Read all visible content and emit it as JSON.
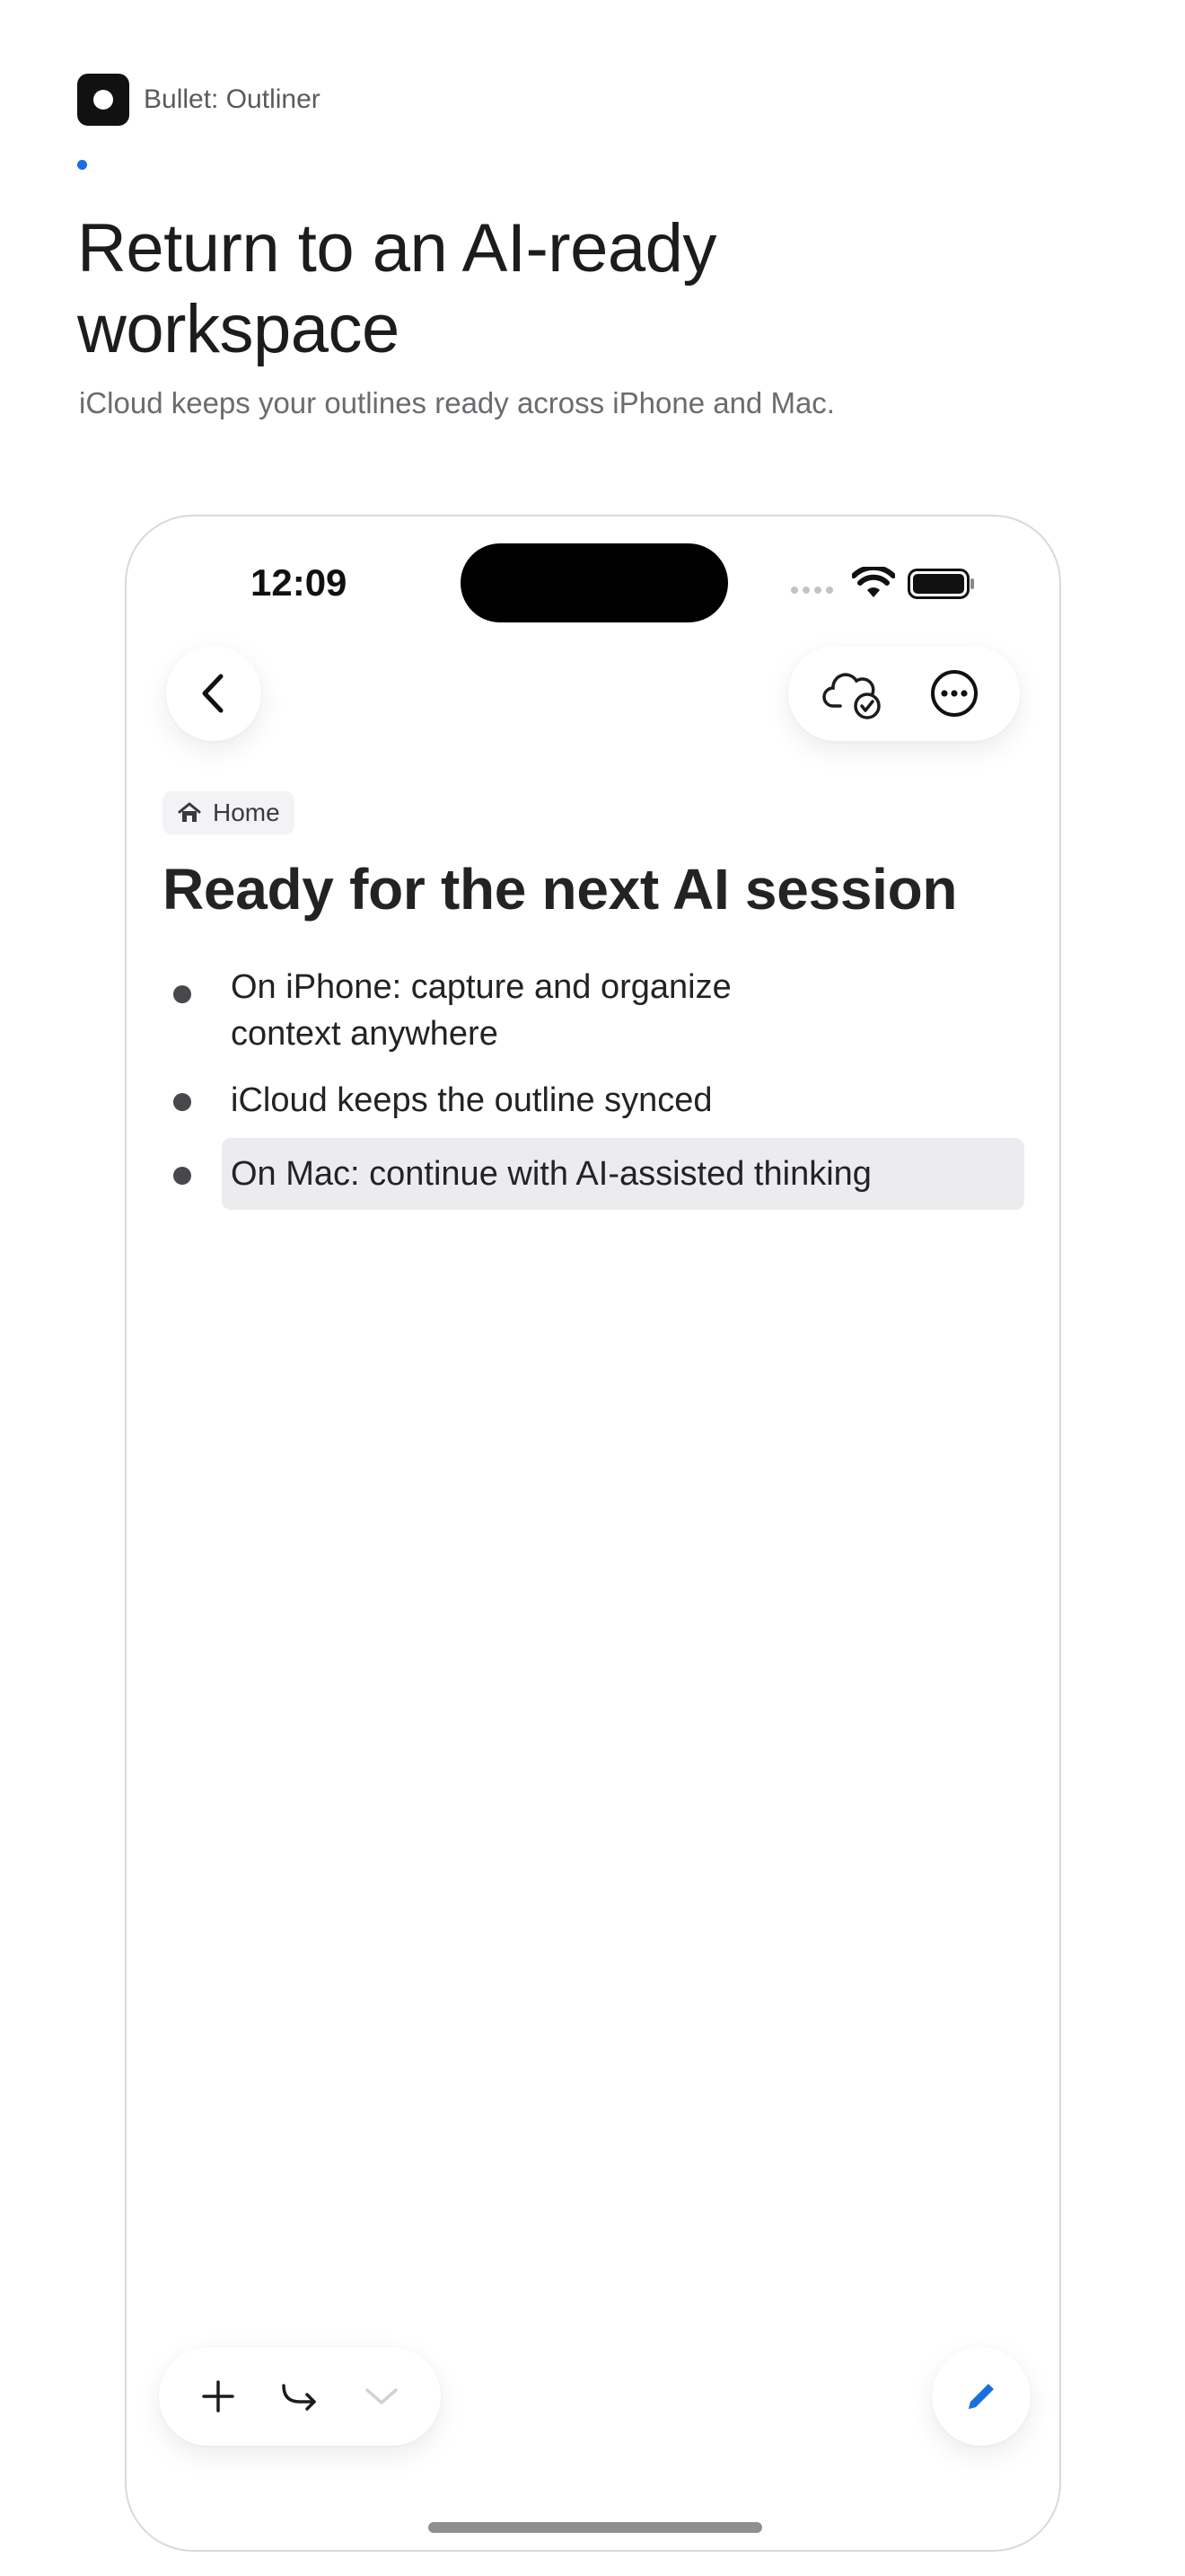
{
  "app": {
    "name": "Bullet: Outliner"
  },
  "hero": {
    "headline": "Return to an AI-ready workspace",
    "subline": "iCloud keeps your outlines ready across iPhone and Mac."
  },
  "device": {
    "status_bar": {
      "time": "12:09"
    },
    "breadcrumb": {
      "label": "Home"
    },
    "document": {
      "title": "Ready for the next AI session",
      "items": [
        {
          "text": "On iPhone: capture and organize context anywhere"
        },
        {
          "text": "iCloud keeps the outline synced"
        },
        {
          "text": "On Mac: continue with AI-assisted thinking",
          "selected": true
        }
      ]
    }
  },
  "colors": {
    "accent": "#1a6fe0",
    "text_primary": "#232326",
    "text_secondary": "#6b6b70",
    "selection": "#ececee"
  },
  "icons": {
    "back": "chevron-left-icon",
    "sync": "cloud-check-icon",
    "more": "ellipsis-circle-icon",
    "home": "house-icon",
    "add": "plus-icon",
    "indent": "indent-arrow-icon",
    "collapse": "chevron-down-icon",
    "compose": "pencil-icon"
  }
}
